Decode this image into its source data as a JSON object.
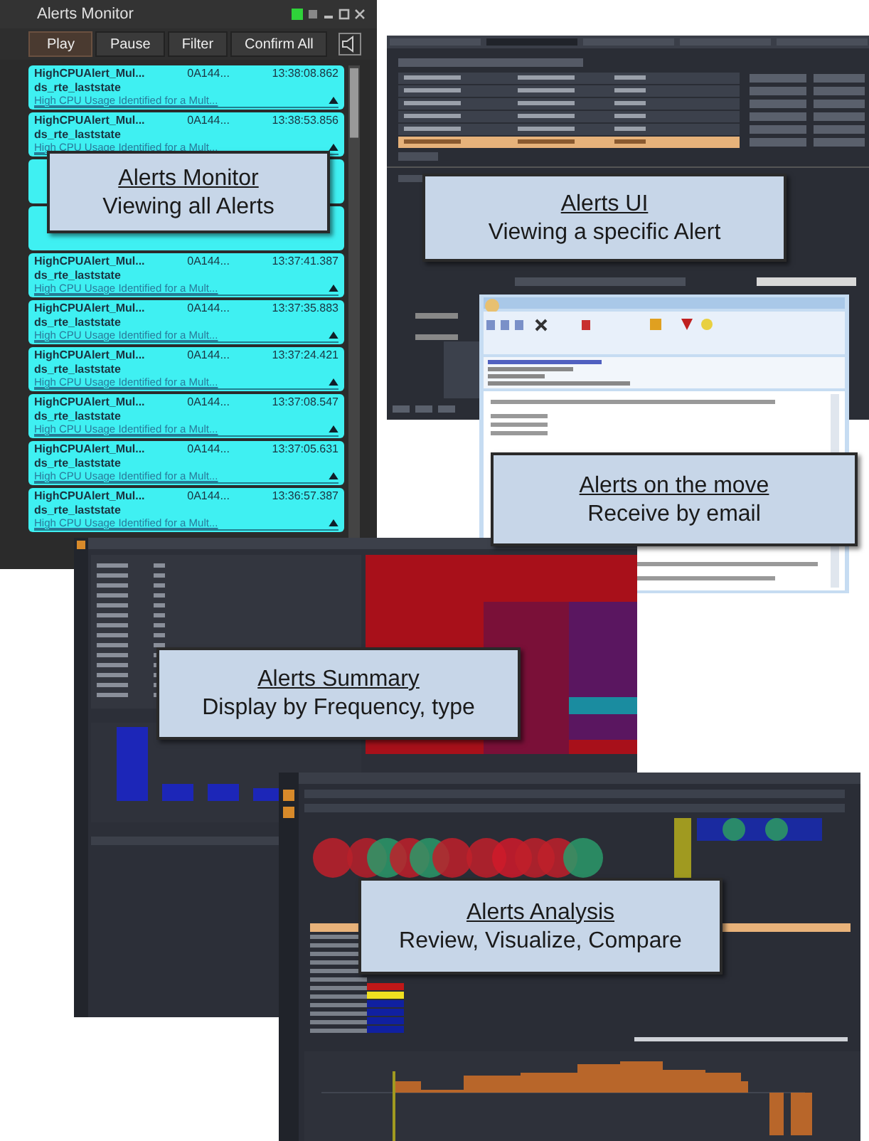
{
  "monitor": {
    "title": "Alerts Monitor",
    "buttons": [
      "Play",
      "Pause",
      "Filter",
      "Confirm All"
    ],
    "alerts": [
      {
        "name": "HighCPUAlert_Mul...",
        "source": "0A144...",
        "time": "13:38:08.862",
        "state": "ds_rte_laststate",
        "description": "High CPU Usage Identified for a Mult..."
      },
      {
        "name": "HighCPUAlert_Mul...",
        "source": "0A144...",
        "time": "13:38:53.856",
        "state": "ds_rte_laststate",
        "description": "High CPU Usage Identified for a Mult..."
      },
      {
        "kind": "covered"
      },
      {
        "kind": "covered"
      },
      {
        "name": "HighCPUAlert_Mul...",
        "source": "0A144...",
        "time": "13:37:41.387",
        "state": "ds_rte_laststate",
        "description": "High CPU Usage Identified for a Mult..."
      },
      {
        "name": "HighCPUAlert_Mul...",
        "source": "0A144...",
        "time": "13:37:35.883",
        "state": "ds_rte_laststate",
        "description": "High CPU Usage Identified for a Mult..."
      },
      {
        "name": "HighCPUAlert_Mul...",
        "source": "0A144...",
        "time": "13:37:24.421",
        "state": "ds_rte_laststate",
        "description": "High CPU Usage Identified for a Mult..."
      },
      {
        "name": "HighCPUAlert_Mul...",
        "source": "0A144...",
        "time": "13:37:08.547",
        "state": "ds_rte_laststate",
        "description": "High CPU Usage Identified for a Mult..."
      },
      {
        "name": "HighCPUAlert_Mul...",
        "source": "0A144...",
        "time": "13:37:05.631",
        "state": "ds_rte_laststate",
        "description": "High CPU Usage Identified for a Mult..."
      },
      {
        "name": "HighCPUAlert_Mul...",
        "source": "0A144...",
        "time": "13:36:57.387",
        "state": "ds_rte_laststate",
        "description": "High CPU Usage Identified for a Mult..."
      }
    ]
  },
  "callouts": [
    {
      "title": "Alerts Monitor",
      "subtitle": "Viewing all Alerts"
    },
    {
      "title": "Alerts UI",
      "subtitle": "Viewing a specific Alert"
    },
    {
      "title": "Alerts on the move",
      "subtitle": "Receive by email"
    },
    {
      "title": "Alerts Summary",
      "subtitle": "Display by Frequency, type"
    },
    {
      "title": "Alerts Analysis",
      "subtitle": "Review, Visualize, Compare"
    }
  ]
}
